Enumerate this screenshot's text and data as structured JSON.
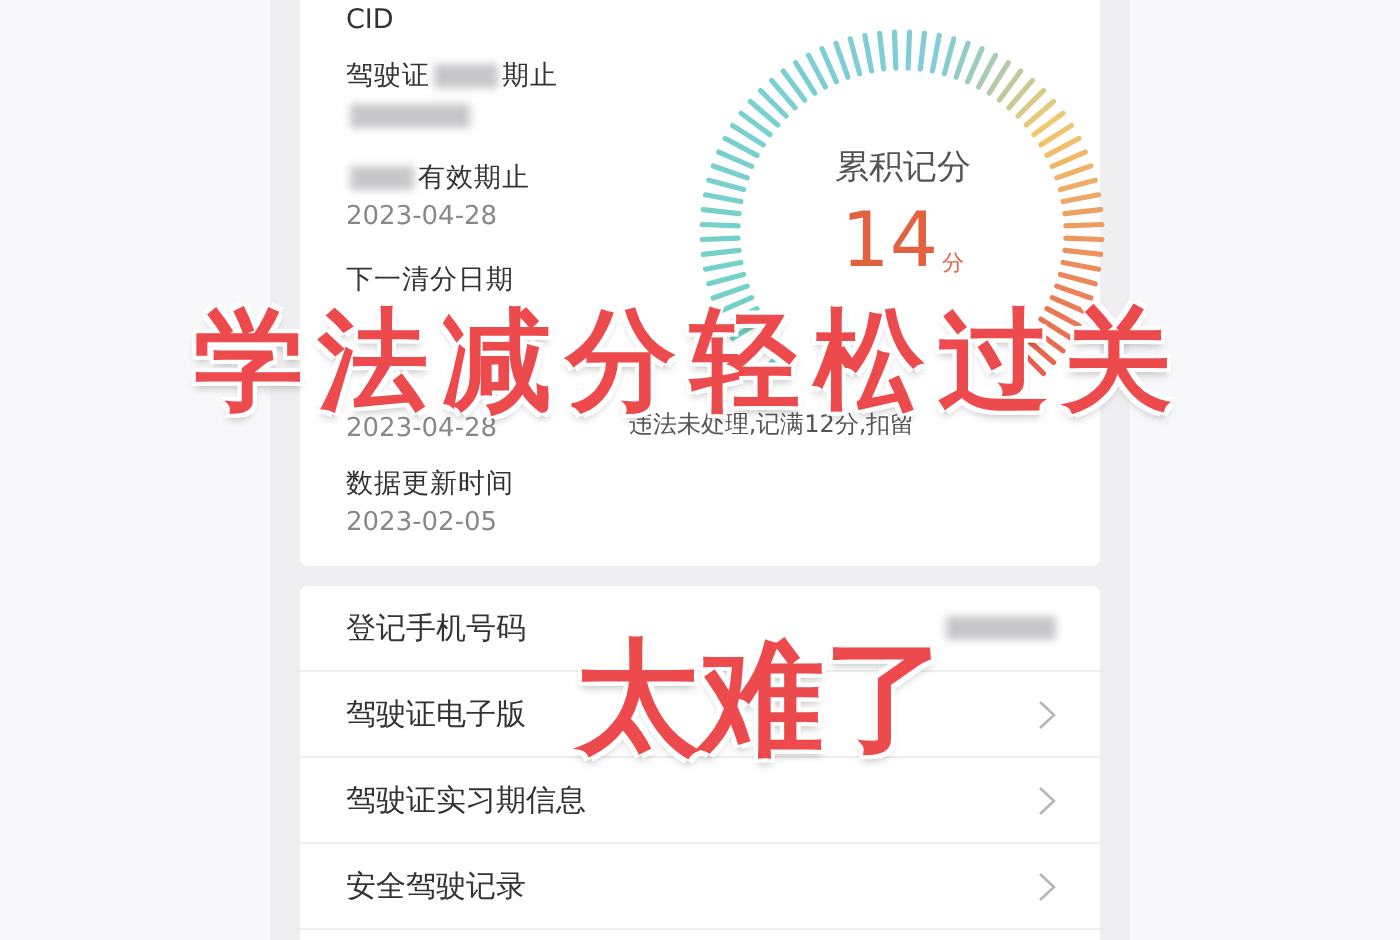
{
  "details": [
    {
      "label": [
        {
          "kind": "text",
          "text": "CID"
        }
      ]
    },
    {
      "label": [
        {
          "kind": "text",
          "text": "驾驶证"
        },
        {
          "kind": "redacted"
        },
        {
          "kind": "text",
          "text": "期止"
        }
      ],
      "value": [
        {
          "kind": "redacted"
        }
      ]
    },
    {
      "label": [
        {
          "kind": "redacted"
        },
        {
          "kind": "text",
          "text": "有效期止"
        }
      ],
      "value": [
        {
          "kind": "text",
          "text": "2023-04-28"
        }
      ]
    },
    {
      "label": [
        {
          "kind": "text",
          "text": "下一清分日期"
        }
      ]
    },
    {
      "value": [
        {
          "kind": "text",
          "text": "2023-04-28"
        }
      ]
    },
    {
      "label": [
        {
          "kind": "text",
          "text": "数据更新时间"
        }
      ],
      "value": [
        {
          "kind": "text",
          "text": "2023-02-05"
        }
      ]
    }
  ],
  "gauge": {
    "title": "累积记分",
    "value": "14",
    "unit": "分",
    "caption": "违法未处理,记满12分,扣留"
  },
  "menu": [
    {
      "label": "登记手机号码",
      "kind": "redacted"
    },
    {
      "label": "驾驶证电子版",
      "kind": "link"
    },
    {
      "label": "驾驶证实习期信息",
      "kind": "link"
    },
    {
      "label": "安全驾驶记录",
      "kind": "link"
    }
  ],
  "overlays": [
    {
      "text": "学法减分轻松过关",
      "kind": "headline"
    },
    {
      "text": "太难了",
      "kind": "sub"
    }
  ]
}
